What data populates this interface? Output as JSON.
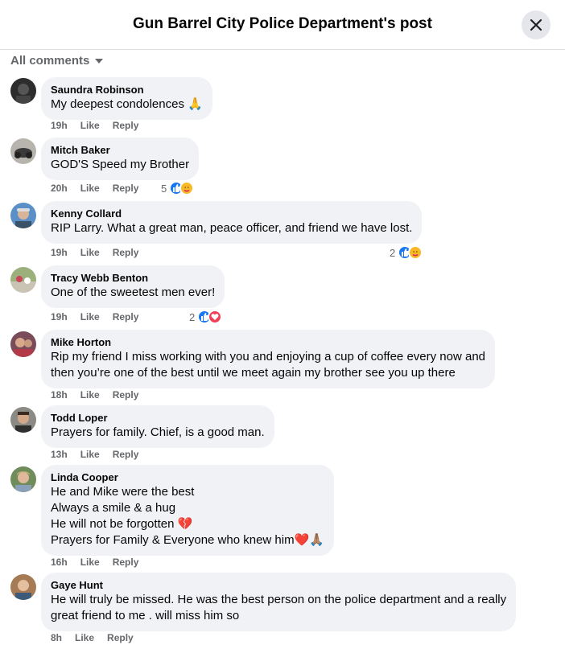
{
  "header": {
    "title": "Gun Barrel City Police Department's post"
  },
  "filter": {
    "label": "All comments"
  },
  "actions": {
    "like": "Like",
    "reply": "Reply"
  },
  "colors": {
    "like_blue": "#1877f2",
    "bubble_bg": "#f0f2f5",
    "muted_text": "#65676b"
  },
  "comments": [
    {
      "author": "Saundra Robinson",
      "text": "My deepest condolences 🙏",
      "time": "19h",
      "reactions": null
    },
    {
      "author": "Mitch Baker",
      "text": "GOD'S Speed my Brother",
      "time": "20h",
      "reactions": {
        "count": "5",
        "types": [
          "like-icon",
          "care-icon"
        ]
      }
    },
    {
      "author": "Kenny Collard",
      "text": "RIP Larry. What a great man, peace officer, and friend we have lost.",
      "time": "19h",
      "reactions": {
        "count": "2",
        "types": [
          "like-icon",
          "care-icon"
        ]
      }
    },
    {
      "author": "Tracy Webb Benton",
      "text": "One of the sweetest men ever!",
      "time": "19h",
      "reactions": {
        "count": "2",
        "types": [
          "like-icon",
          "love-icon"
        ]
      }
    },
    {
      "author": "Mike Horton",
      "text": "Rip my friend I miss working with you and enjoying a cup of coffee every now and\nthen you’re one of the best until we meet again my brother see you up there",
      "time": "18h",
      "reactions": null
    },
    {
      "author": "Todd Loper",
      "text": "Prayers for family. Chief, is a good man.",
      "time": "13h",
      "reactions": null
    },
    {
      "author": "Linda Cooper",
      "text": "He and Mike were the best\nAlways a smile & a hug\nHe will not be forgotten 💔\nPrayers for Family & Everyone who knew him❤️🙏🏽",
      "time": "16h",
      "reactions": null
    },
    {
      "author": "Gaye Hunt",
      "text": "He will truly be missed. He was the best person on the police department and a really\ngreat friend to me . will miss him so",
      "time": "8h",
      "reactions": null
    }
  ]
}
